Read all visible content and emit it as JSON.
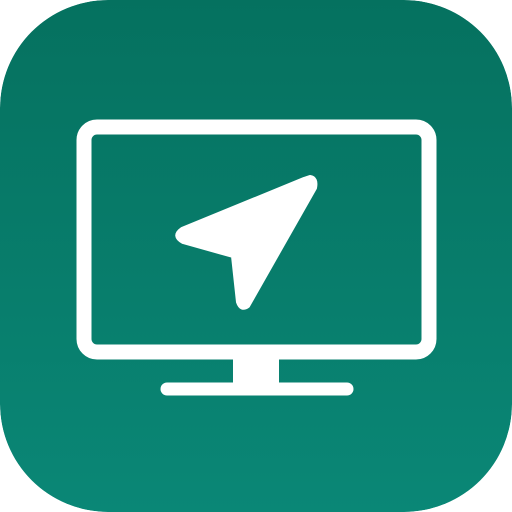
{
  "app_icon": {
    "icon": "monitor-with-navigation-arrow-icon",
    "colors": {
      "background_top": "#05715F",
      "background_bottom": "#0A8776",
      "glyph": "#FFFFFF"
    }
  }
}
